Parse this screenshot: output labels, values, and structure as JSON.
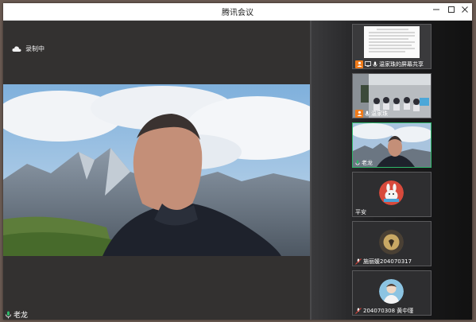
{
  "window": {
    "title": "腾讯会议"
  },
  "recording": {
    "label": "录制中"
  },
  "main_speaker": {
    "name": "老龙"
  },
  "participants": [
    {
      "name": "温家珠的屏幕共享",
      "type": "screen-share"
    },
    {
      "name": "温家珠",
      "type": "camera"
    },
    {
      "name": "老龙",
      "type": "camera",
      "active": true
    },
    {
      "name": "平安",
      "type": "avatar"
    },
    {
      "name": "施丽媛204070317",
      "type": "avatar"
    },
    {
      "name": "204070308 黄中瑾",
      "type": "avatar"
    }
  ],
  "colors": {
    "accent": "#2fb86a",
    "badge": "#f07c1b",
    "main_bg": "#333130",
    "panel_bg": "#1e1e20"
  }
}
